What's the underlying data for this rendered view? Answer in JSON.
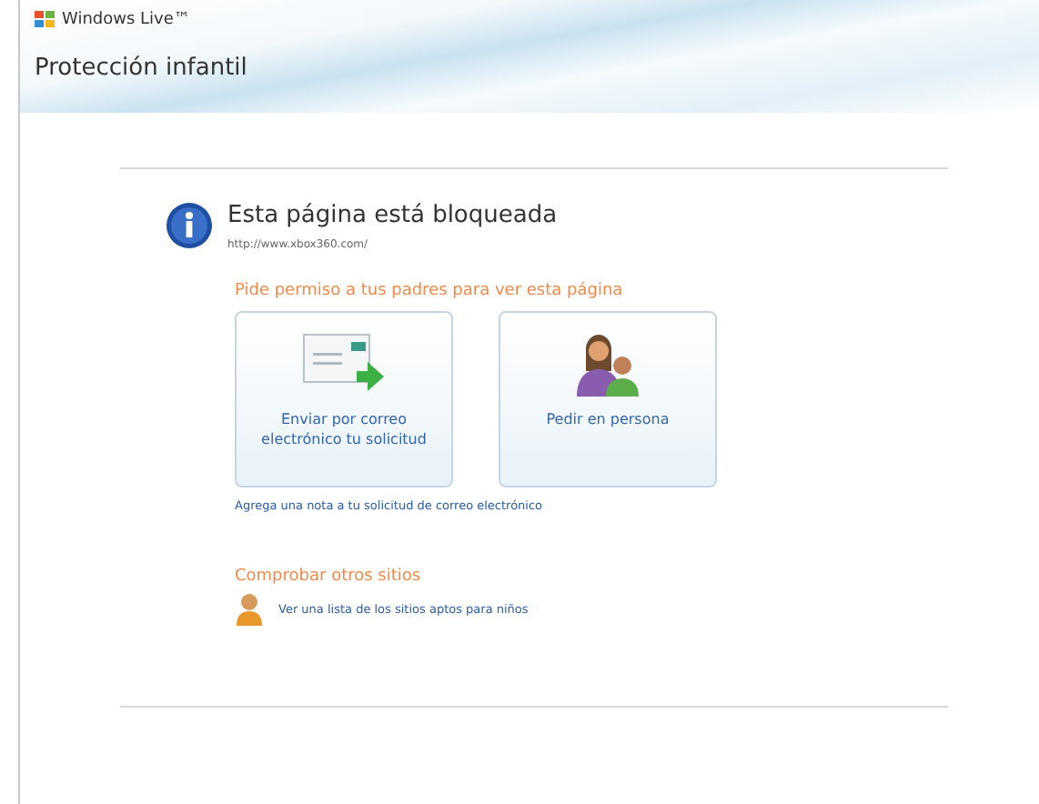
{
  "header": {
    "brand": "Windows Live™",
    "title": "Protección infantil"
  },
  "notice": {
    "heading": "Esta página está bloqueada",
    "url": "http://www.xbox360.com/"
  },
  "request": {
    "heading": "Pide permiso a tus padres para ver esta página",
    "options": [
      {
        "kind": "email",
        "label": "Enviar por correo electrónico tu solicitud"
      },
      {
        "kind": "person",
        "label": "Pedir en persona"
      }
    ],
    "note_link": "Agrega una nota a tu solicitud de correo electrónico"
  },
  "other": {
    "heading": "Comprobar otros sitios",
    "link": "Ver una lista de los sitios aptos para niños"
  }
}
